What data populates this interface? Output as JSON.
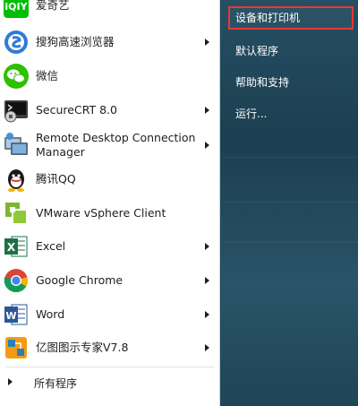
{
  "start_menu": {
    "programs": [
      {
        "label": "爱奇艺",
        "icon": "iqiyi-icon",
        "has_submenu": false
      },
      {
        "label": "搜狗高速浏览器",
        "icon": "sogou-browser-icon",
        "has_submenu": true
      },
      {
        "label": "微信",
        "icon": "wechat-icon",
        "has_submenu": false
      },
      {
        "label": "SecureCRT 8.0",
        "icon": "securecrt-icon",
        "has_submenu": true
      },
      {
        "label_line1": "Remote Desktop Connection",
        "label_line2": "Manager",
        "icon": "remote-desktop-icon",
        "has_submenu": true
      },
      {
        "label": "腾讯QQ",
        "icon": "qq-icon",
        "has_submenu": false
      },
      {
        "label": "VMware vSphere Client",
        "icon": "vmware-icon",
        "has_submenu": false
      },
      {
        "label": "Excel",
        "icon": "excel-icon",
        "has_submenu": true
      },
      {
        "label": "Google Chrome",
        "icon": "chrome-icon",
        "has_submenu": true
      },
      {
        "label": "Word",
        "icon": "word-icon",
        "has_submenu": true
      },
      {
        "label": "亿图图示专家V7.8",
        "icon": "edraw-icon",
        "has_submenu": true
      }
    ],
    "all_programs": "所有程序",
    "right_links": [
      {
        "label": "设备和打印机",
        "highlighted": true
      },
      {
        "label": "默认程序",
        "highlighted": false
      },
      {
        "label": "帮助和支持",
        "highlighted": false
      },
      {
        "label": "运行...",
        "highlighted": false
      }
    ],
    "colors": {
      "highlight_border": "#e53935",
      "right_panel": "#1f4556",
      "left_panel": "#ffffff"
    }
  }
}
